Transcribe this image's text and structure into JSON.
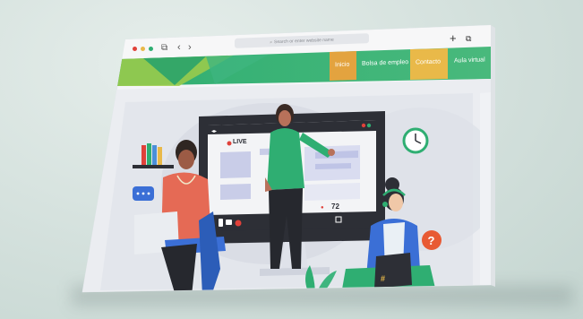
{
  "browser": {
    "address_placeholder": "Search or enter website name"
  },
  "nav": {
    "items": [
      {
        "label": "Inicio",
        "color": "#e3a33f"
      },
      {
        "label": "Bolsa de empleo",
        "color": "#3bb58a"
      },
      {
        "label": "Contacto",
        "color": "#e9b949"
      },
      {
        "label": "Aula virtual",
        "color": "#35b083"
      }
    ]
  },
  "screen": {
    "live_label": "LIVE",
    "viewer_count": "72"
  },
  "colors": {
    "accent_green": "#2fae72",
    "live_red": "#e0413a",
    "help_orange": "#e85a34"
  }
}
